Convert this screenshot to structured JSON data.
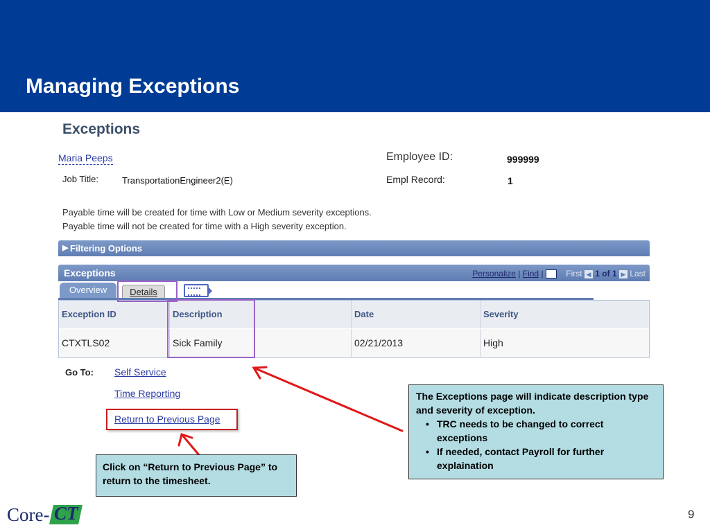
{
  "slide": {
    "title": "Managing Exceptions",
    "page_number": "9"
  },
  "ps_page": {
    "title": "Exceptions",
    "employee_name": "Maria Peeps",
    "job_title_label": "Job Title:",
    "job_title_value": "TransportationEngineer2(E)",
    "employee_id_label": "Employee ID:",
    "employee_id_value": "999999",
    "empl_record_label": "Empl Record:",
    "empl_record_value": "1",
    "note_line1": "Payable time will be created for time with Low or Medium severity exceptions.",
    "note_line2": "Payable time will not be created for time with a High severity exception.",
    "filtering_options": "Filtering Options"
  },
  "grid": {
    "title": "Exceptions",
    "personalize": "Personalize",
    "find": "Find",
    "first": "First",
    "count": "1 of 1",
    "last": "Last",
    "tabs": {
      "overview": "Overview",
      "details": "Details"
    },
    "columns": [
      "Exception ID",
      "Description",
      "Date",
      "Severity"
    ],
    "rows": [
      [
        "CTXTLS02",
        "Sick Family",
        "02/21/2013",
        "High"
      ]
    ]
  },
  "goto": {
    "label": "Go To:",
    "self_service": "Self Service",
    "time_reporting": "Time Reporting",
    "return_previous": "Return to Previous Page"
  },
  "callouts": {
    "left": "Click on “Return to Previous Page” to return to the timesheet.",
    "right_intro": "The Exceptions page will indicate description type and severity of exception.",
    "right_bullets": [
      "TRC needs to be changed to correct exceptions",
      "If needed, contact Payroll for further explaination"
    ]
  },
  "logo": {
    "text_core": "Core-",
    "text_ct": "CT"
  },
  "colors": {
    "banner": "#003c96",
    "callout_bg": "#b3dce3",
    "highlight_purple": "#9a63c7",
    "highlight_red": "#c81e1e"
  }
}
